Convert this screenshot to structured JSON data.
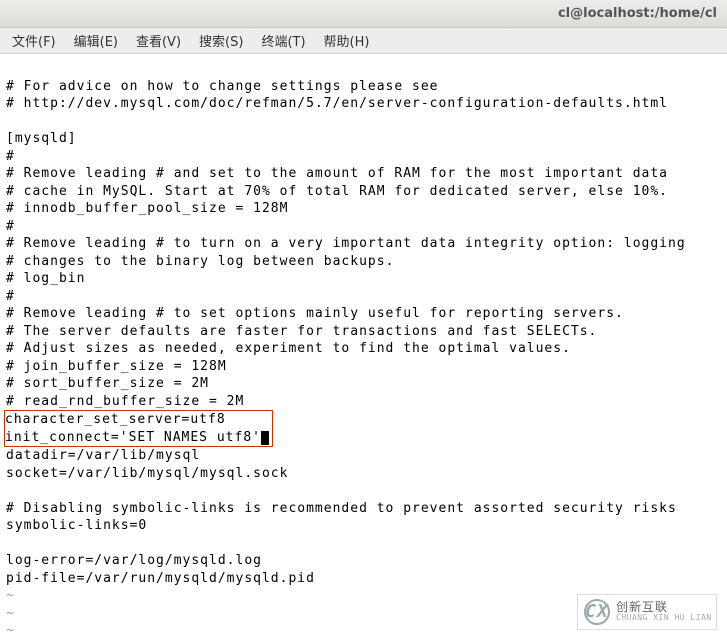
{
  "window": {
    "title": "cl@localhost:/home/cl"
  },
  "menu": {
    "file": "文件(F)",
    "edit": "编辑(E)",
    "view": "查看(V)",
    "search": "搜索(S)",
    "terminal": "终端(T)",
    "help": "帮助(H)"
  },
  "config": {
    "l01": "# For advice on how to change settings please see",
    "l02": "# http://dev.mysql.com/doc/refman/5.7/en/server-configuration-defaults.html",
    "l03": "",
    "l04": "[mysqld]",
    "l05": "#",
    "l06": "# Remove leading # and set to the amount of RAM for the most important data",
    "l07": "# cache in MySQL. Start at 70% of total RAM for dedicated server, else 10%.",
    "l08": "# innodb_buffer_pool_size = 128M",
    "l09": "#",
    "l10": "# Remove leading # to turn on a very important data integrity option: logging",
    "l11": "# changes to the binary log between backups.",
    "l12": "# log_bin",
    "l13": "#",
    "l14": "# Remove leading # to set options mainly useful for reporting servers.",
    "l15": "# The server defaults are faster for transactions and fast SELECTs.",
    "l16": "# Adjust sizes as needed, experiment to find the optimal values.",
    "l17": "# join_buffer_size = 128M",
    "l18": "# sort_buffer_size = 2M",
    "l19": "# read_rnd_buffer_size = 2M",
    "hl1": "character_set_server=utf8     ",
    "hl2": "init_connect='SET NAMES utf8'",
    "l22": "datadir=/var/lib/mysql",
    "l23": "socket=/var/lib/mysql/mysql.sock",
    "l24": "",
    "l25": "# Disabling symbolic-links is recommended to prevent assorted security risks",
    "l26": "symbolic-links=0",
    "l27": "",
    "l28": "log-error=/var/log/mysqld.log",
    "l29": "pid-file=/var/run/mysqld/mysqld.pid"
  },
  "tilde": "~",
  "logo": {
    "mark": "CX",
    "cn": "创新互联",
    "py": "CHUANG XIN HU LIAN"
  }
}
